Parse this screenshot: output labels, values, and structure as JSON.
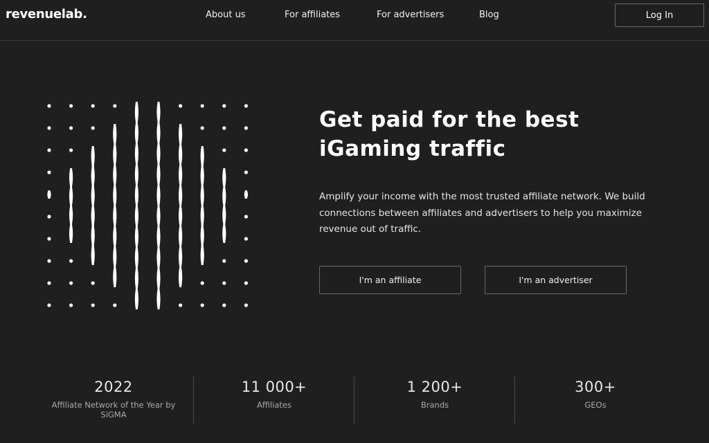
{
  "header": {
    "logo": "revenuelab.",
    "nav": [
      {
        "label": "About us"
      },
      {
        "label": "For affiliates"
      },
      {
        "label": "For advertisers"
      },
      {
        "label": "Blog"
      }
    ],
    "login_label": "Log In"
  },
  "hero": {
    "title_line1": "Get paid for the best",
    "title_line2": "iGaming traffic",
    "description": "Amplify your income with the most trusted affiliate network. We build connections between affiliates and advertisers to help you maximize revenue out of traffic.",
    "affiliate_button": "I'm an affiliate",
    "advertiser_button": "I'm an advertiser"
  },
  "stats": [
    {
      "value": "2022",
      "label": "Affiliate Network of the Year by SiGMA"
    },
    {
      "value": "11 000+",
      "label": "Affiliates"
    },
    {
      "value": "1 200+",
      "label": "Brands"
    },
    {
      "value": "300+",
      "label": "GEOs"
    }
  ],
  "colors": {
    "background": "#1f1f1f",
    "text": "#ffffff",
    "muted": "#a9a9a9",
    "border": "#6a6a6a"
  }
}
